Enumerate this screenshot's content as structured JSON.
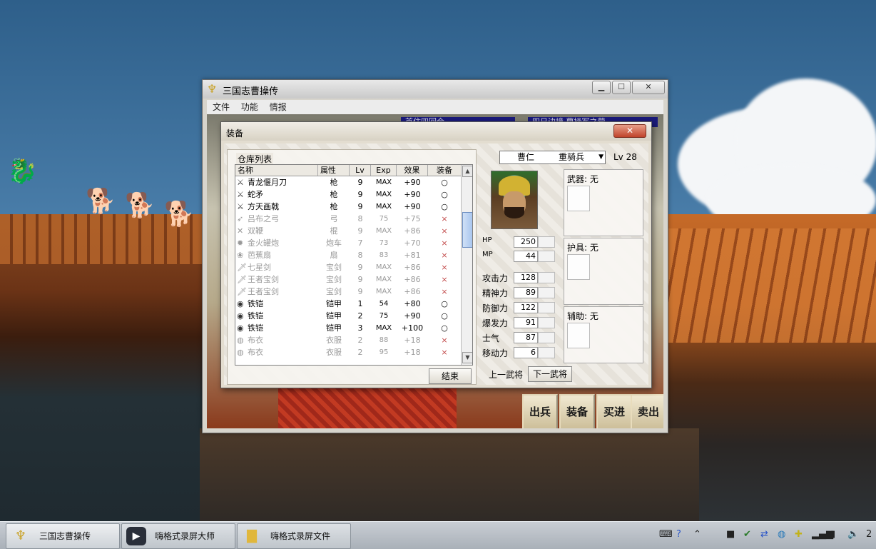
{
  "game_window": {
    "title": "三国志曹操传",
    "menu": [
      "文件",
      "功能",
      "情报"
    ],
    "banners": [
      "首住四回合",
      "四日边境 曹操军之营"
    ],
    "command_buttons": [
      "出兵",
      "装备",
      "买进",
      "卖出"
    ]
  },
  "dialog": {
    "title": "装备",
    "close_label": "✕",
    "group_label": "仓库列表",
    "columns": [
      "名称",
      "属性",
      "Lv",
      "Exp",
      "效果",
      "装备"
    ],
    "rows": [
      {
        "icon": "spear",
        "name": "青龙偃月刀",
        "type": "枪",
        "lv": "9",
        "exp": "MAX",
        "effect": "+90",
        "equip": "○",
        "dim": false
      },
      {
        "icon": "spear",
        "name": "蛇矛",
        "type": "枪",
        "lv": "9",
        "exp": "MAX",
        "effect": "+90",
        "equip": "○",
        "dim": false
      },
      {
        "icon": "spear",
        "name": "方天画戟",
        "type": "枪",
        "lv": "9",
        "exp": "MAX",
        "effect": "+90",
        "equip": "○",
        "dim": false
      },
      {
        "icon": "bow",
        "name": "吕布之弓",
        "type": "弓",
        "lv": "8",
        "exp": "75",
        "effect": "+75",
        "equip": "×",
        "dim": true
      },
      {
        "icon": "whip",
        "name": "双鞭",
        "type": "棍",
        "lv": "9",
        "exp": "MAX",
        "effect": "+86",
        "equip": "×",
        "dim": true
      },
      {
        "icon": "cannon",
        "name": "金火罐炮",
        "type": "炮车",
        "lv": "7",
        "exp": "73",
        "effect": "+70",
        "equip": "×",
        "dim": true
      },
      {
        "icon": "fan",
        "name": "芭蕉扇",
        "type": "扇",
        "lv": "8",
        "exp": "83",
        "effect": "+81",
        "equip": "×",
        "dim": true
      },
      {
        "icon": "sword",
        "name": "七星剑",
        "type": "宝剑",
        "lv": "9",
        "exp": "MAX",
        "effect": "+86",
        "equip": "×",
        "dim": true
      },
      {
        "icon": "sword",
        "name": "王者宝剑",
        "type": "宝剑",
        "lv": "9",
        "exp": "MAX",
        "effect": "+86",
        "equip": "×",
        "dim": true
      },
      {
        "icon": "sword",
        "name": "王者宝剑",
        "type": "宝剑",
        "lv": "9",
        "exp": "MAX",
        "effect": "+86",
        "equip": "×",
        "dim": true
      },
      {
        "icon": "armor",
        "name": "铁铠",
        "type": "铠甲",
        "lv": "1",
        "exp": "54",
        "effect": "+80",
        "equip": "○",
        "dim": false
      },
      {
        "icon": "armor",
        "name": "铁铠",
        "type": "铠甲",
        "lv": "2",
        "exp": "75",
        "effect": "+90",
        "equip": "○",
        "dim": false
      },
      {
        "icon": "armor",
        "name": "铁铠",
        "type": "铠甲",
        "lv": "3",
        "exp": "MAX",
        "effect": "+100",
        "equip": "○",
        "dim": false
      },
      {
        "icon": "cloth",
        "name": "布衣",
        "type": "衣服",
        "lv": "2",
        "exp": "88",
        "effect": "+18",
        "equip": "×",
        "dim": true
      },
      {
        "icon": "cloth",
        "name": "布衣",
        "type": "衣服",
        "lv": "2",
        "exp": "95",
        "effect": "+18",
        "equip": "×",
        "dim": true
      }
    ],
    "end_button": "结束",
    "general": {
      "name": "曹仁",
      "class": "重骑兵",
      "level": "Lv 28",
      "stats": [
        {
          "label": "HP",
          "value": "250"
        },
        {
          "label": "MP",
          "value": "44"
        },
        {
          "label": "攻击力",
          "value": "128"
        },
        {
          "label": "精神力",
          "value": "89"
        },
        {
          "label": "防御力",
          "value": "122"
        },
        {
          "label": "爆发力",
          "value": "91"
        },
        {
          "label": "士气",
          "value": "87"
        },
        {
          "label": "移动力",
          "value": "6"
        }
      ],
      "slots": [
        {
          "label": "武器: 无"
        },
        {
          "label": "护具: 无"
        },
        {
          "label": "辅助: 无"
        }
      ],
      "prev_button": "上一武将",
      "next_button": "下一武将"
    }
  },
  "taskbar": {
    "items": [
      "三国志曹操传",
      "嗨格式录屏大师",
      "嗨格式录屏文件"
    ],
    "clock": "2"
  }
}
